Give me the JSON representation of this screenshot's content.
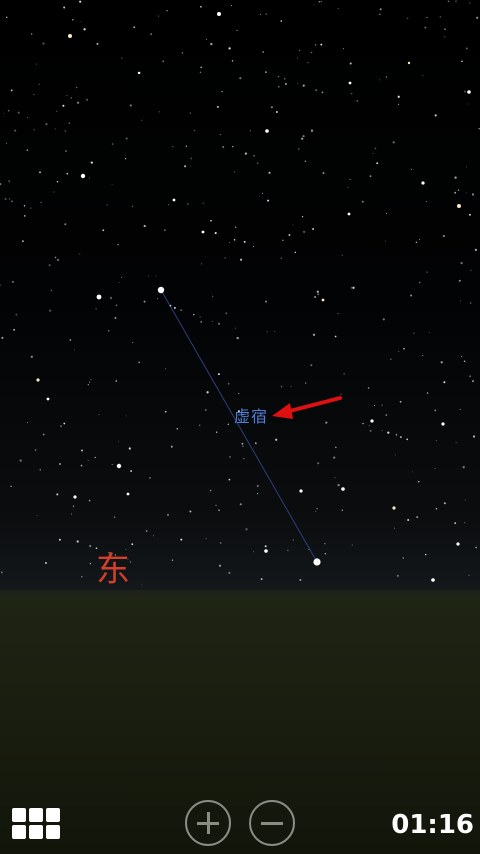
{
  "sky": {
    "constellation_label": "虚宿",
    "cardinal_direction": "东",
    "label_color": "#4f7fd6",
    "cardinal_color": "#d0402a",
    "arrow_color": "#e01010"
  },
  "controls": {
    "menu_icon": "grid-menu-icon",
    "zoom_in_icon": "plus-circle-icon",
    "zoom_out_icon": "minus-circle-icon"
  },
  "status": {
    "time": "01:16"
  }
}
